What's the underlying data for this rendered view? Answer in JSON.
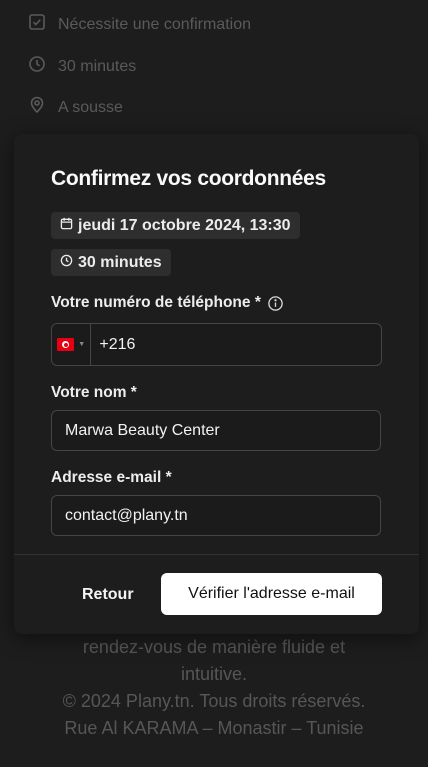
{
  "background": {
    "rows": [
      {
        "icon": "checkbox-icon",
        "text": "Nécessite une confirmation"
      },
      {
        "icon": "clock-icon",
        "text": "30 minutes"
      },
      {
        "icon": "location-pin-icon",
        "text": "A sousse"
      }
    ],
    "footer_lines": [
      "rendez-vous de manière fluide et",
      "intuitive.",
      "© 2024 Plany.tn. Tous droits réservés.",
      "Rue Al KARAMA – Monastir – Tunisie"
    ]
  },
  "modal": {
    "title": "Confirmez vos coordonnées",
    "date_chip": "jeudi 17 octobre 2024, 13:30",
    "duration_chip": "30 minutes",
    "phone_label": "Votre numéro de téléphone *",
    "phone_country_code": "+216",
    "phone_flag": "tunisia-flag",
    "name_label": "Votre nom *",
    "name_value": "Marwa Beauty Center",
    "email_label": "Adresse e-mail *",
    "email_value": "contact@plany.tn",
    "back_button": "Retour",
    "verify_button": "Vérifier l'adresse e-mail"
  }
}
